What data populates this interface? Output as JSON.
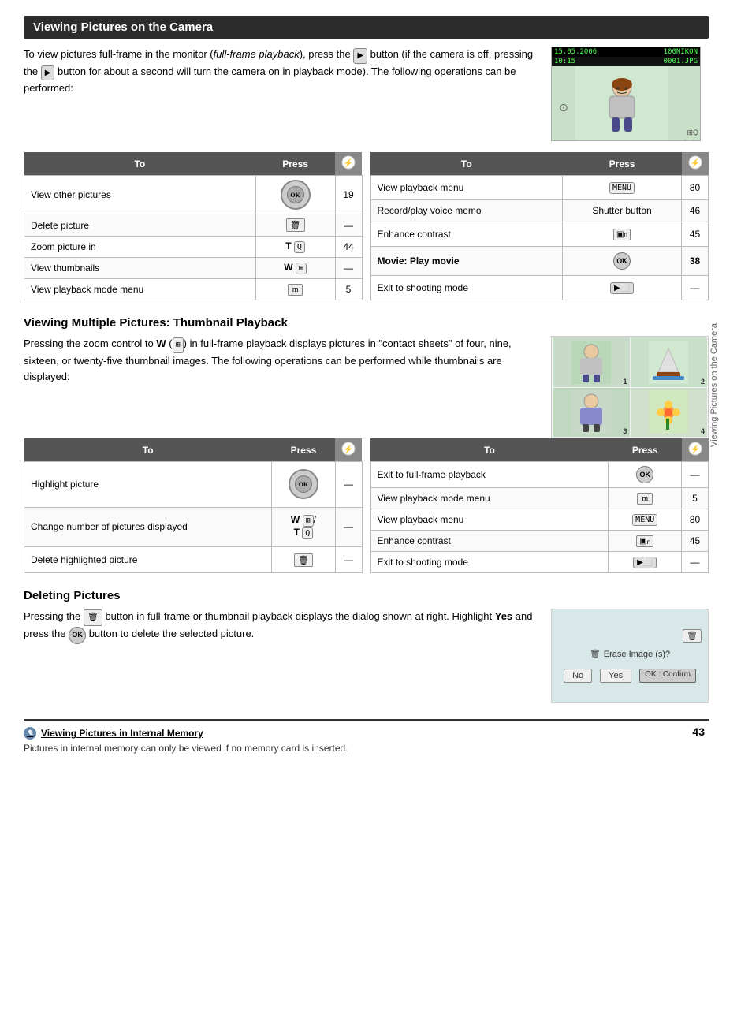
{
  "page": {
    "title": "Viewing Pictures on the Camera",
    "page_number": "43",
    "side_label": "Viewing Pictures on the Camera"
  },
  "intro": {
    "text_1": "To view pictures full-frame in the monitor (",
    "text_italic": "full-frame playback",
    "text_2": "), press the",
    "text_3": "button (if the camera is off, pressing the",
    "text_4": "button for about a second will turn the camera on in playback mode). The following operations can be performed:"
  },
  "table1_left": {
    "headers": [
      "To",
      "Press",
      ""
    ],
    "rows": [
      {
        "to": "View other pictures",
        "press": "OK_DIAL",
        "num": "19"
      },
      {
        "to": "Delete picture",
        "press": "TRASH",
        "num": "—"
      },
      {
        "to": "Zoom picture in",
        "press": "T(Q)",
        "num": "44"
      },
      {
        "to": "View thumbnails",
        "press": "W(thumbnail)",
        "num": "—"
      },
      {
        "to": "View playback mode menu",
        "press": "m",
        "num": "5"
      }
    ]
  },
  "table1_right": {
    "headers": [
      "To",
      "Press",
      ""
    ],
    "rows": [
      {
        "to": "View playback menu",
        "press": "MENU",
        "num": "80"
      },
      {
        "to": "Record/play voice memo",
        "press": "Shutter button",
        "num": "46"
      },
      {
        "to": "Enhance contrast",
        "press": "ENHANCE",
        "num": "45"
      },
      {
        "to": "Movie: Play movie",
        "press": "OK_SMALL",
        "num": "38",
        "bold": true
      },
      {
        "to": "Exit to shooting mode",
        "press": "PLAYBACK",
        "num": "—"
      }
    ]
  },
  "section2": {
    "title": "Viewing Multiple Pictures: Thumbnail Playback",
    "text": "Pressing the zoom control to W (  ) in full-frame playback displays pictures in \"contact sheets\" of four, nine, sixteen, or twenty-five thumbnail images. The following operations can be performed while thumbnails are displayed:"
  },
  "table2_left": {
    "headers": [
      "To",
      "Press",
      ""
    ],
    "rows": [
      {
        "to": "Highlight picture",
        "press": "OK_DIAL",
        "num": "—"
      },
      {
        "to": "Change number of pictures displayed",
        "press": "W_T",
        "num": "—"
      },
      {
        "to": "Delete highlighted picture",
        "press": "TRASH",
        "num": "—"
      }
    ]
  },
  "table2_right": {
    "headers": [
      "To",
      "Press",
      ""
    ],
    "rows": [
      {
        "to": "Exit to full-frame playback",
        "press": "OK_SMALL",
        "num": "—"
      },
      {
        "to": "View playback mode menu",
        "press": "m",
        "num": "5"
      },
      {
        "to": "View playback menu",
        "press": "MENU",
        "num": "80"
      },
      {
        "to": "Enhance contrast",
        "press": "ENHANCE",
        "num": "45"
      },
      {
        "to": "Exit to shooting mode",
        "press": "PLAYBACK",
        "num": "—"
      }
    ]
  },
  "section3": {
    "title": "Deleting Pictures",
    "text_1": "Pressing the",
    "text_2": "button in full-frame or thumbnail playback displays the dialog shown at right. Highlight",
    "text_bold": "Yes",
    "text_3": "and press the",
    "text_4": "button to delete the selected picture."
  },
  "note": {
    "icon": "✎",
    "title": "Viewing Pictures in Internal Memory",
    "text": "Pictures in internal memory can only be viewed if no memory card is inserted."
  },
  "camera_display": {
    "date": "15.05.2006",
    "folder": "100NIKON",
    "file": "0001.JPG",
    "time": "10:15"
  }
}
